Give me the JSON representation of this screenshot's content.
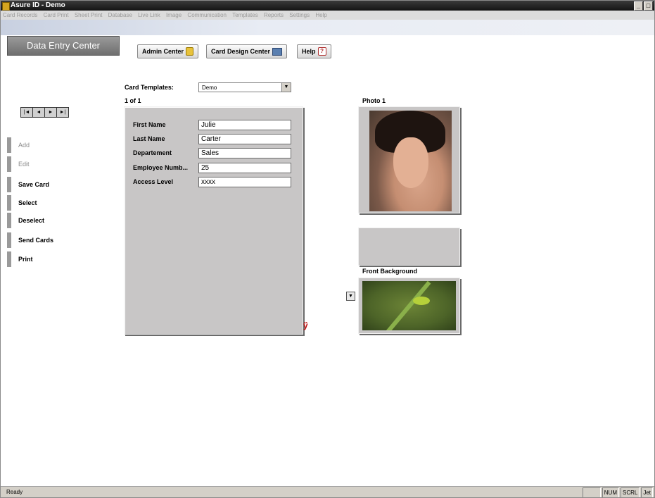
{
  "window": {
    "title": "Asure ID - Demo",
    "min_label": "_",
    "restore_label": "7"
  },
  "menu": [
    "Card Records",
    "Card Print",
    "Sheet Print",
    "Database",
    "Live Link",
    "Image",
    "Communication",
    "Templates",
    "Reports",
    "Settings",
    "Help"
  ],
  "section_title": "Data Entry Center",
  "top_buttons": {
    "admin": "Admin Center",
    "design": "Card Design Center",
    "help": "Help"
  },
  "templates": {
    "label": "Card Templates:",
    "value": "Demo"
  },
  "record_counter": "1 of 1",
  "nav_buttons": [
    "|◄",
    "◄",
    "►",
    "►|"
  ],
  "sidebar": [
    {
      "label": "Add",
      "enabled": false
    },
    {
      "label": "Edit",
      "enabled": false
    },
    {
      "label": "Save Card",
      "enabled": true
    },
    {
      "label": "Select",
      "enabled": true
    },
    {
      "label": "Deselect",
      "enabled": true
    },
    {
      "label": "Send Cards",
      "enabled": true
    },
    {
      "label": "Print",
      "enabled": true
    }
  ],
  "fields": [
    {
      "label": "First Name",
      "value": "Julie"
    },
    {
      "label": "Last Name",
      "value": "Carter"
    },
    {
      "label": "Departement",
      "value": "Sales"
    },
    {
      "label": "Employee Numb...",
      "value": "25"
    },
    {
      "label": "Access Level",
      "value": "xxxx"
    }
  ],
  "photo_label": "Photo 1",
  "front_background_label": "Front Background",
  "status": {
    "text": "Ready",
    "cells": [
      "",
      "NUM",
      "SCRL",
      "Jet"
    ]
  }
}
